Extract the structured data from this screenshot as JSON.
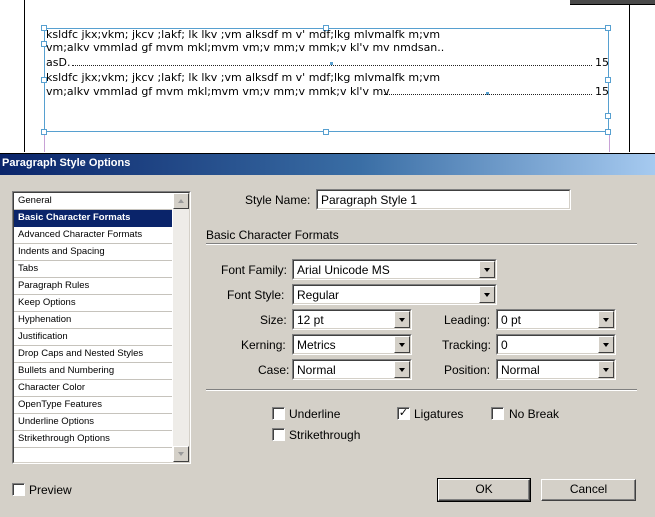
{
  "document": {
    "lines": [
      {
        "text": "ksldfc jkx;vkm; jkcv ;lakf; lk lkv ;vm alksdf m v' mdf;lkg mlvmalfk m;vm"
      },
      {
        "text": "vm;alkv vmmlad gf  mvm mkl;mvm vm;v mm;v mmk;v kl'v mv nmdsan.."
      },
      {
        "text": "asD.",
        "page": "15"
      },
      {
        "text": "ksldfc jkx;vkm; jkcv ;lakf; lk lkv ;vm alksdf m v' mdf;lkg mlvmalfk m;vm"
      },
      {
        "text": "vm;alkv vmmlad gf  mvm mkl;mvm vm;v mm;v mmk;v kl'v mv",
        "page": "15"
      }
    ]
  },
  "dialog": {
    "title": "Paragraph Style Options",
    "categories": [
      "General",
      "Basic Character Formats",
      "Advanced Character Formats",
      "Indents and Spacing",
      "Tabs",
      "Paragraph Rules",
      "Keep Options",
      "Hyphenation",
      "Justification",
      "Drop Caps and Nested Styles",
      "Bullets and Numbering",
      "Character Color",
      "OpenType Features",
      "Underline Options",
      "Strikethrough Options"
    ],
    "selected_category": "Basic Character Formats",
    "style_name_label": "Style Name:",
    "style_name_value": "Paragraph Style 1",
    "section_title": "Basic Character Formats",
    "font_family": {
      "label": "Font Family:",
      "value": "Arial Unicode MS"
    },
    "font_style": {
      "label": "Font Style:",
      "value": "Regular"
    },
    "size": {
      "label": "Size:",
      "value": "12 pt"
    },
    "leading": {
      "label": "Leading:",
      "value": "0 pt"
    },
    "kerning": {
      "label": "Kerning:",
      "value": "Metrics"
    },
    "tracking": {
      "label": "Tracking:",
      "value": "0"
    },
    "case": {
      "label": "Case:",
      "value": "Normal"
    },
    "position": {
      "label": "Position:",
      "value": "Normal"
    },
    "checkboxes": {
      "underline": {
        "label": "Underline",
        "checked": false
      },
      "ligatures": {
        "label": "Ligatures",
        "checked": true
      },
      "no_break": {
        "label": "No Break",
        "checked": false
      },
      "strikethrough": {
        "label": "Strikethrough",
        "checked": false
      }
    },
    "preview": {
      "label": "Preview",
      "checked": false
    },
    "ok_label": "OK",
    "cancel_label": "Cancel",
    "check_mark": "✓",
    "colors": {
      "titlebar_start": "#0a246a",
      "titlebar_end": "#a6caf0",
      "selection": "#0a246a",
      "frame": "#57a0d0"
    }
  }
}
